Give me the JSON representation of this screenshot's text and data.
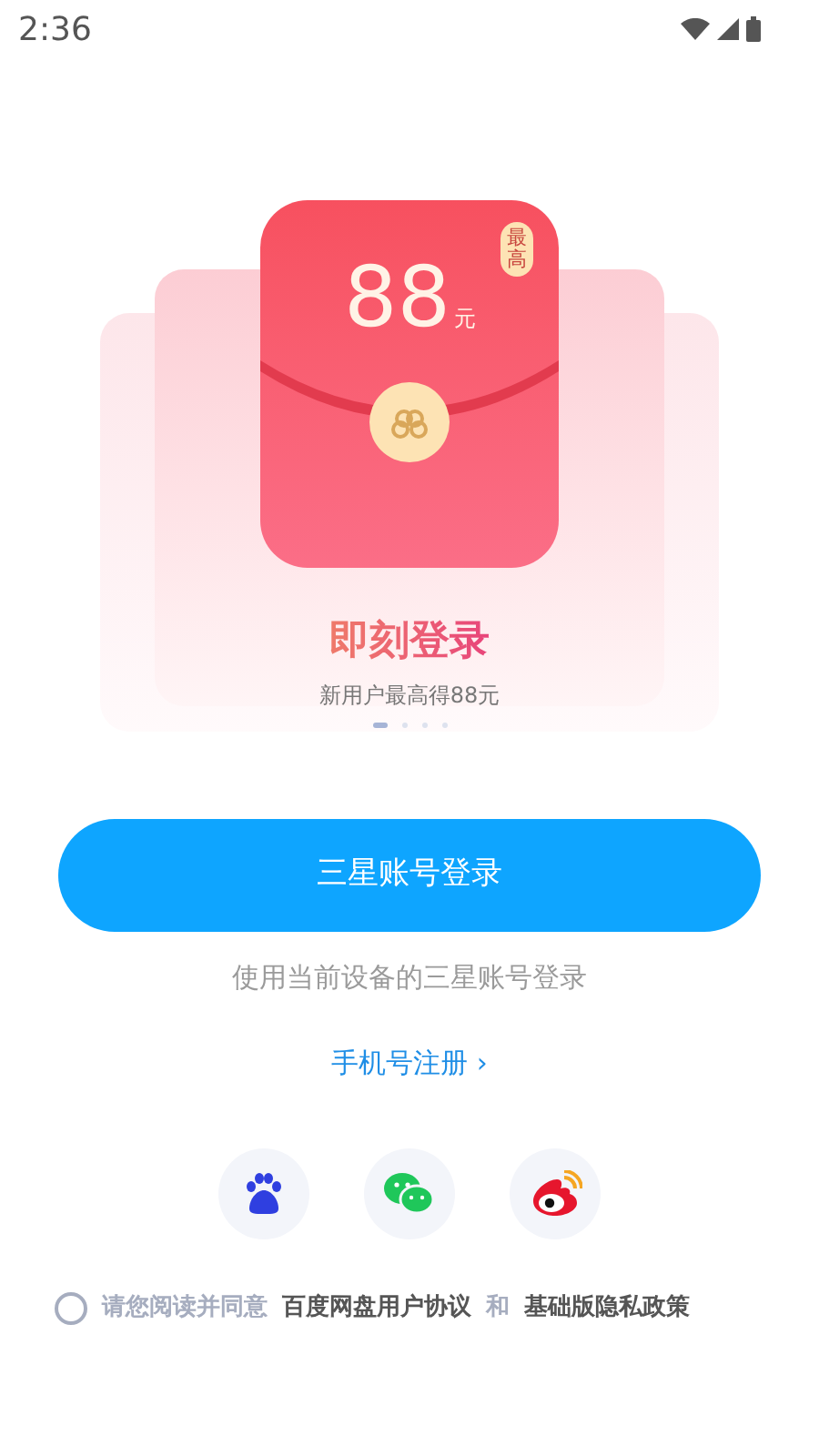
{
  "status_bar": {
    "time": "2:36"
  },
  "banner": {
    "amount": "88",
    "unit": "元",
    "max_tag": "最高",
    "title": "即刻登录",
    "subtitle": "新用户最高得88元",
    "dots": [
      {
        "selected": true
      },
      {
        "selected": false
      },
      {
        "selected": false
      },
      {
        "selected": false
      }
    ]
  },
  "primary_button": "三星账号登录",
  "hint": "使用当前设备的三星账号登录",
  "register_link": "手机号注册 ›",
  "social_logins": [
    {
      "kind": "baidu"
    },
    {
      "kind": "wechat"
    },
    {
      "kind": "weibo"
    }
  ],
  "agreement": {
    "checked": false,
    "prefix": "请您阅读并同意",
    "link_1": "百度网盘用户协议",
    "joiner": "和",
    "link_2": "基础版隐私政策"
  }
}
